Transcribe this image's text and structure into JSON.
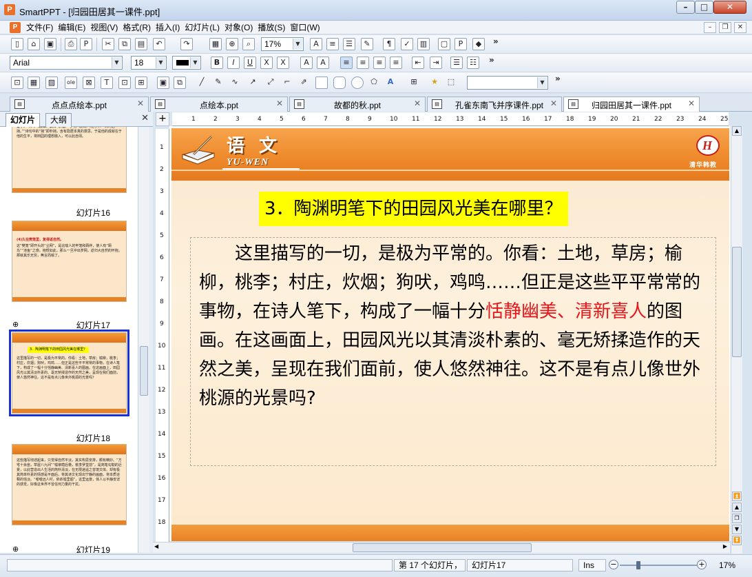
{
  "window": {
    "title": "SmartPPT - [归园田居其一课件.ppt]"
  },
  "menu": [
    "文件(F)",
    "编辑(E)",
    "视图(V)",
    "格式(R)",
    "插入(I)",
    "幻灯片(L)",
    "对象(O)",
    "播放(S)",
    "窗口(W)"
  ],
  "toolbar": {
    "zoom": "17%",
    "font": "Arial",
    "font_size": "18",
    "more": "»"
  },
  "doc_tabs": [
    {
      "label": "点点点绘本.ppt"
    },
    {
      "label": "点绘本.ppt"
    },
    {
      "label": "故都的秋.ppt"
    },
    {
      "label": "孔雀东南飞并序课件.ppt"
    },
    {
      "label": "归园田居其一课件.ppt"
    }
  ],
  "panel": {
    "tab_slides": "幻灯片",
    "tab_outline": "大纲"
  },
  "thumbnails": [
    {
      "label": "幻灯片16",
      "text": "以“羁鸟”和“池鱼”作对比，衬托，说明自己被“羁鸟”和“池鱼”一般平在官场沉浮，返回田园使我的愿意，现在终于做到了，他的笔法，清楚了。“林”。《群海》解释“茶缠。与“方”根间。《老子》：“大巧若拙。”“诗句中的“拙”即朴拙，含有隐居本真的意思。于是他的成就在于他的生平，将田园的理想融入，可以此自诩。"
    },
    {
      "label": "幻灯片17",
      "banner": "(4)久在樊笼里，复得返自然。",
      "text": "这“樊笼”即开头的“尘网”，是比喻人的牢笼和羁绊，使人有“羁鸟”“池鱼”之感。抱恨如此，那么一旦冲出罗网，返归大自然的怀抱，那就其乐无穷，無言而喻了。"
    },
    {
      "label": "幻灯片18",
      "banner": "3．陶渊明笔下的田园风光美在哪里？",
      "text": "这里描写的一切，是极为平常的。你看：土地，草房；榆柳，桃李；村庄，炊烟；狗吠，鸡鸣……但正是这些平平常常的事物，在诗人笔下，构成了一幅十分恬静幽美、清新喜人的图画。在这画面上，田园风光以其清淡朴素的、毫无矫揉造作的天然之美，呈现在我们面前，使人悠然神往。这不是有点儿像世外桃源的光景吗？"
    },
    {
      "label": "幻灯片19",
      "text": "这些描写彻述起来，只觉得自然平淡，其实构思安排，颇有精妙。“方宅十余亩，草屋八九间”“榆柳荫后檐，桃李罗堂前”，是简笔勾勒的近景，以此营造出人生活的简朴清淡，在无限逍遥之曾境文体。却有极其简单朴素的情感是平面后，将其诗文化现出宁静的画面，将本质诠释的恬淡。“嗳嗳远人村，依依墟里烟”，这里运景，体人以平静安详的感觉，好像这世界不曾任何力量的干扰。"
    }
  ],
  "slide": {
    "header_title": "语 文",
    "header_sub": "YU-WEN",
    "brand": "清华韩教",
    "question": "3．陶渊明笔下的田园风光美在哪里？",
    "body_pre": "　　这里描写的一切，是极为平常的。你看：土地，草房；榆柳，桃李；村庄，炊烟；狗吠，鸡鸣……但正是这些平平常常的事物，在诗人笔下，构成了一幅十分",
    "body_highlight": "恬静幽美、清新喜人",
    "body_post": "的图画。在这画面上，田园风光以其清淡朴素的、毫无矫揉造作的天然之美，呈现在我们面前，使人悠然神往。这不是有点儿像世外桃源的光景吗?"
  },
  "ruler": {
    "h": [
      "1",
      "2",
      "3",
      "4",
      "5",
      "6",
      "7",
      "8",
      "9",
      "10",
      "11",
      "12",
      "13",
      "14",
      "15",
      "16",
      "17",
      "18",
      "19",
      "20",
      "21",
      "22",
      "23",
      "24",
      "25"
    ],
    "v": [
      "1",
      "2",
      "3",
      "4",
      "5",
      "6",
      "7",
      "8",
      "9",
      "10",
      "11",
      "12",
      "13",
      "14",
      "15",
      "16",
      "17",
      "18"
    ]
  },
  "status": {
    "slide_count": "第 17 个幻灯片，",
    "slide_name": "幻灯片17",
    "ins": "Ins",
    "zoom": "17%"
  },
  "colors": {
    "highlight_red": "#e8151b",
    "question_bg": "#ffff00",
    "selection_blue": "#1a31d6",
    "header_orange": "#ee8a2c"
  }
}
